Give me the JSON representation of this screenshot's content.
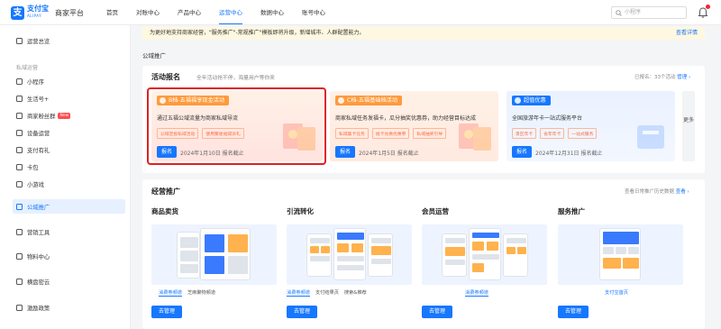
{
  "header": {
    "logo_cn": "支付宝",
    "logo_en": "ALIPAY",
    "platform": "商家平台",
    "nav": [
      "首页",
      "对账中心",
      "产品中心",
      "运营中心",
      "数据中心",
      "账号中心"
    ],
    "active_nav": "运营中心",
    "search_placeholder": "小程序"
  },
  "sidebar": {
    "item_overview": "运营总览",
    "group_private": "私域运营",
    "items": [
      "小程序",
      "生活号+",
      "商家粉丝群",
      "设备运营",
      "支付有礼",
      "卡包",
      "小游戏"
    ],
    "badge_new": "New",
    "item_public": "公域推广",
    "item_marketing": "营销工具",
    "item_materials": "物料中心",
    "item_jiubei": "横盘密云",
    "item_incentive": "激励政策"
  },
  "notice": {
    "text": "为更好地支持商家经营，\"服务推广\"-常规推广\"模板即将升级，新增城市、人群配置能力。",
    "link": "查看详情"
  },
  "section": {
    "public_promo": "公域推广"
  },
  "activity": {
    "title": "活动报名",
    "subtitle": "全年活动抢不停，海量用户等你来",
    "registered": "已报名：33个活动",
    "manage": "管理 ›",
    "more": "更多",
    "cards": [
      {
        "tag": "B档-五福福享现金活动",
        "desc": "通过五福公域流量为商家私域导流",
        "chips": [
          "公域定投私域活动",
          "使用繁星福袋派礼"
        ],
        "button": "报名",
        "deadline": "2024年1月10日 报名截止",
        "accent": "#ff9a3c"
      },
      {
        "tag": "C档-五福基础档活动",
        "desc": "商家私域任务发福卡，瓜分抽奖优惠券，助力经营目标达成",
        "chips": [
          "私域集卡任务",
          "福卡兑换优惠券",
          "私域抽奖引导"
        ],
        "button": "报名",
        "deadline": "2024年1月5日 报名截止",
        "accent": "#ff9a3c"
      },
      {
        "tag": "超值优惠",
        "desc": "全国旅游年卡一站式服务平台",
        "chips": [
          "景区年卡",
          "省年年卡",
          "一站式服务"
        ],
        "button": "报名",
        "deadline": "2024年12月31日 报名截止",
        "accent": "#1677ff"
      }
    ]
  },
  "operation": {
    "title": "经营推广",
    "right_label": "查看日常推广历史数据",
    "right_link": "查看 ›",
    "columns": [
      {
        "title": "商品卖货",
        "tabs": [
          "消费券频道",
          "芝麻聚物频道"
        ],
        "active_tab": 0,
        "button": "去管理"
      },
      {
        "title": "引流转化",
        "tabs": [
          "消费券频道",
          "支付结果页",
          "搜索&推荐"
        ],
        "active_tab": 0,
        "button": "去管理"
      },
      {
        "title": "会员运营",
        "tabs": [
          "消费券频道"
        ],
        "active_tab": 0,
        "button": "去管理"
      },
      {
        "title": "服务推广",
        "tabs": [
          "支付宝首页"
        ],
        "active_tab": 0,
        "button": "去管理"
      }
    ]
  },
  "colors": {
    "brand": "#1677ff",
    "highlight": "#e02020",
    "orange": "#ff9a3c"
  }
}
